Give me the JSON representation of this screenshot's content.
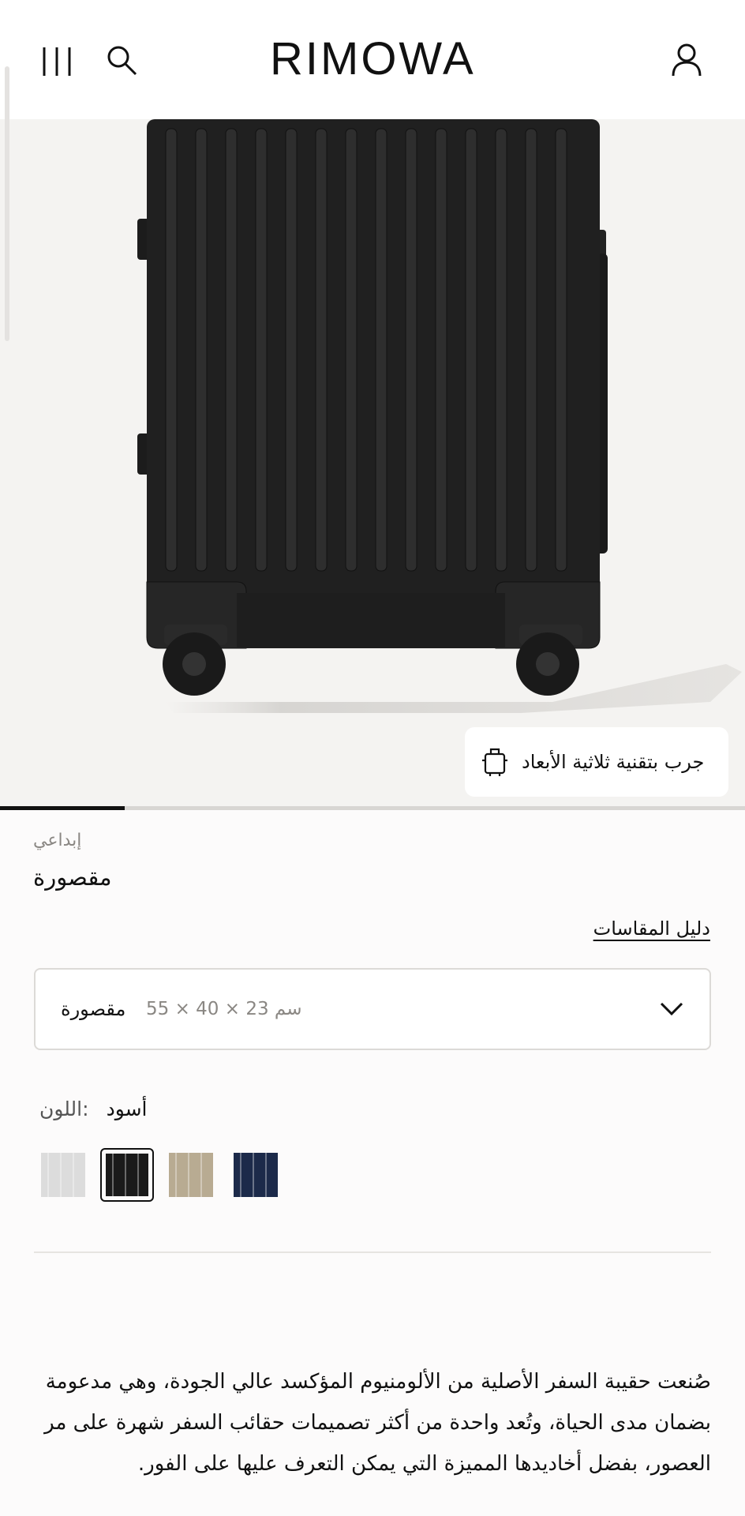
{
  "header": {
    "logo": "RIMOWA",
    "icons": [
      "menu-icon",
      "search-icon",
      "account-icon"
    ]
  },
  "gallery": {
    "ar_button_label": "جرب بتقنية ثلاثية الأبعاد",
    "ar_icon": "3d-suitcase-icon",
    "progress": 0.167
  },
  "product": {
    "collection": "إبداعي",
    "name": "مقصورة",
    "size_guide_label": "دليل المقاسات",
    "size_select": {
      "selected_name": "مقصورة",
      "selected_dims": "55 × 40 × 23 سم"
    },
    "color": {
      "label": "اللون:",
      "value": "أسود",
      "swatches": [
        {
          "name": "silver",
          "color": "#dcdcdc",
          "selected": false
        },
        {
          "name": "black",
          "color": "#1a1a1a",
          "selected": true
        },
        {
          "name": "titanium",
          "color": "#b8ab92",
          "selected": false
        },
        {
          "name": "navy",
          "color": "#1c2a4a",
          "selected": false
        }
      ]
    },
    "description": "صُنعت حقيبة السفر الأصلية من الألومنيوم المؤكسد عالي الجودة، وهي مدعومة بضمان مدى الحياة، وتُعد واحدة من أكثر تصميمات حقائب السفر شهرة على مر العصور، بفضل أخاديدها المميزة التي يمكن التعرف عليها على الفور."
  }
}
